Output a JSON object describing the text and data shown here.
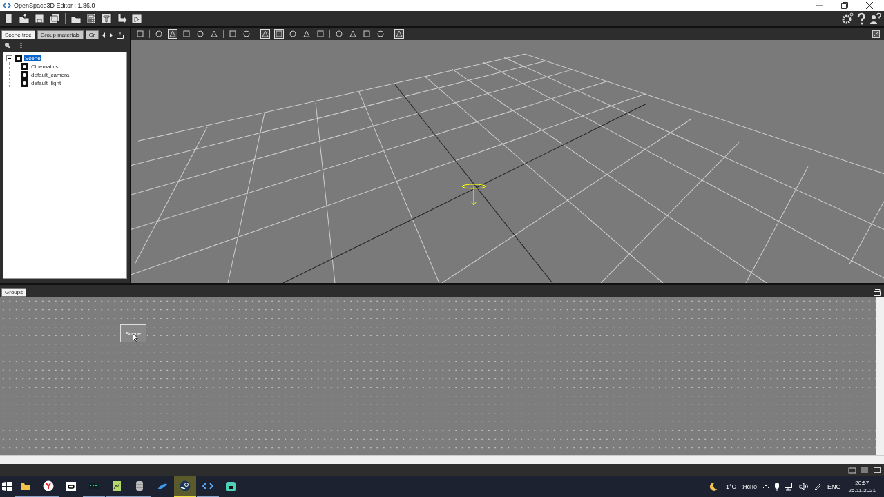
{
  "window": {
    "title": "OpenSpace3D Editor : 1.86.0"
  },
  "left_panel": {
    "tabs": [
      {
        "label": "Scene tree",
        "selected": true
      },
      {
        "label": "Group materials",
        "selected": false
      },
      {
        "label": "Gr",
        "selected": false
      }
    ],
    "tree": [
      {
        "label": "Scene",
        "selected": true,
        "expanded": true,
        "children": [
          {
            "label": "Cinematics",
            "selected": false
          },
          {
            "label": "default_camera",
            "selected": false
          },
          {
            "label": "default_light",
            "selected": false
          }
        ]
      }
    ]
  },
  "viewport_toolbar": [
    {
      "pressed": false
    },
    {
      "pressed": false
    },
    {
      "pressed": true
    },
    {
      "pressed": false
    },
    {
      "pressed": false
    },
    {
      "pressed": false
    },
    {
      "pressed": false
    },
    {
      "pressed": false
    },
    {
      "pressed": true
    },
    {
      "pressed": true
    },
    {
      "pressed": false
    },
    {
      "pressed": false
    },
    {
      "pressed": false
    },
    {
      "pressed": false
    },
    {
      "pressed": false
    },
    {
      "pressed": false
    },
    {
      "pressed": false
    },
    {
      "pressed": true
    }
  ],
  "groups_panel": {
    "tab": {
      "label": "Groups",
      "selected": true
    },
    "nodes": [
      {
        "label": "Scene"
      }
    ]
  },
  "taskbar": {
    "apps": [
      {
        "kind": "explorer",
        "running": true,
        "selected": false
      },
      {
        "kind": "browser",
        "running": true,
        "selected": false
      },
      {
        "kind": "headset",
        "running": false,
        "selected": false
      },
      {
        "kind": "terminal",
        "running": true,
        "selected": false
      },
      {
        "kind": "notepad",
        "running": true,
        "selected": false
      },
      {
        "kind": "database",
        "running": true,
        "selected": false
      },
      {
        "kind": "swoosh",
        "running": false,
        "selected": false
      },
      {
        "kind": "steam",
        "running": true,
        "selected": true
      },
      {
        "kind": "openspace",
        "running": true,
        "selected": false
      },
      {
        "kind": "lock",
        "running": false,
        "selected": false
      }
    ],
    "weather": {
      "temperature": "-1°C",
      "condition": "Ясно"
    },
    "language": "ENG",
    "time": "20:57",
    "date": "25.11.2021"
  }
}
